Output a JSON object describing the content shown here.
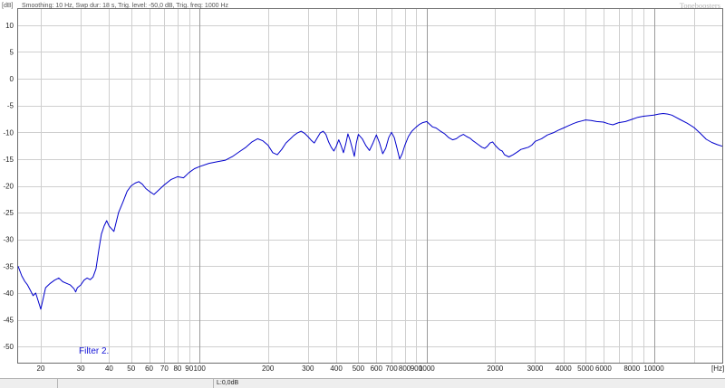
{
  "chart_data": {
    "type": "line",
    "header": "Smoothing: 10 Hz, Swp dur: 18 s, Trig. level: -50,0 dB, Trig. freq: 1000 Hz",
    "brand": "Toneboosters",
    "ylabel": "[dB]",
    "xlabel": "[Hz]",
    "x_scale": "log",
    "xlim": [
      15.9,
      20000
    ],
    "ylim": [
      -53,
      13
    ],
    "grid": true,
    "y_ticks": [
      10,
      5,
      0,
      -5,
      -10,
      -15,
      -20,
      -25,
      -30,
      -35,
      -40,
      -45,
      -50
    ],
    "x_ticks": [
      {
        "value": 20,
        "label": "20"
      },
      {
        "value": 30,
        "label": "30"
      },
      {
        "value": 40,
        "label": "40"
      },
      {
        "value": 50,
        "label": "50"
      },
      {
        "value": 60,
        "label": "60"
      },
      {
        "value": 70,
        "label": "70"
      },
      {
        "value": 80,
        "label": "80"
      },
      {
        "value": 90,
        "label": "90"
      },
      {
        "value": 100,
        "label": "100"
      },
      {
        "value": 200,
        "label": "200"
      },
      {
        "value": 300,
        "label": "300"
      },
      {
        "value": 400,
        "label": "400"
      },
      {
        "value": 500,
        "label": "500"
      },
      {
        "value": 600,
        "label": "600"
      },
      {
        "value": 700,
        "label": "700"
      },
      {
        "value": 800,
        "label": "800"
      },
      {
        "value": 900,
        "label": "900"
      },
      {
        "value": 1000,
        "label": "1000"
      },
      {
        "value": 2000,
        "label": "2000"
      },
      {
        "value": 3000,
        "label": "3000"
      },
      {
        "value": 4000,
        "label": "4000"
      },
      {
        "value": 5000,
        "label": "5000"
      },
      {
        "value": 6000,
        "label": "6000"
      },
      {
        "value": 8000,
        "label": "8000"
      },
      {
        "value": 10000,
        "label": "10000"
      }
    ],
    "series": [
      {
        "color": "#0000cc",
        "x": [
          15.9,
          16.5,
          17.0,
          17.5,
          18.0,
          18.5,
          19.0,
          19.5,
          20.0,
          20.5,
          21.0,
          22.0,
          23.0,
          24.0,
          25.0,
          26.0,
          27.0,
          28.0,
          28.5,
          29.0,
          30.0,
          31.0,
          32.0,
          33.0,
          34.0,
          35.0,
          36.0,
          37.0,
          38.0,
          39.0,
          40.0,
          42.0,
          44.0,
          46.0,
          48.0,
          50.0,
          52.0,
          54.0,
          56.0,
          58.0,
          60.0,
          63.0,
          66.0,
          70.0,
          75.0,
          80.0,
          85.0,
          90.0,
          95.0,
          100.0,
          110.0,
          120.0,
          130.0,
          140.0,
          150.0,
          160.0,
          170.0,
          180.0,
          190.0,
          200.0,
          210.0,
          220.0,
          230.0,
          240.0,
          250.0,
          260.0,
          270.0,
          280.0,
          290.0,
          300.0,
          310.0,
          320.0,
          330.0,
          340.0,
          350.0,
          360.0,
          370.0,
          380.0,
          390.0,
          400.0,
          410.0,
          420.0,
          430.0,
          440.0,
          450.0,
          460.0,
          470.0,
          480.0,
          490.0,
          500.0,
          520.0,
          540.0,
          560.0,
          580.0,
          600.0,
          620.0,
          640.0,
          660.0,
          680.0,
          700.0,
          720.0,
          740.0,
          760.0,
          780.0,
          800.0,
          830.0,
          860.0,
          900.0,
          930.0,
          960.0,
          1000.0,
          1030.0,
          1060.0,
          1100.0,
          1150.0,
          1200.0,
          1250.0,
          1300.0,
          1350.0,
          1400.0,
          1450.0,
          1500.0,
          1550.0,
          1600.0,
          1650.0,
          1700.0,
          1750.0,
          1800.0,
          1850.0,
          1900.0,
          1950.0,
          2000.0,
          2050.0,
          2100.0,
          2150.0,
          2200.0,
          2300.0,
          2400.0,
          2500.0,
          2600.0,
          2700.0,
          2800.0,
          2900.0,
          3000.0,
          3200.0,
          3400.0,
          3600.0,
          3800.0,
          4000.0,
          4200.0,
          4400.0,
          4600.0,
          4800.0,
          5000.0,
          5300.0,
          5600.0,
          6000.0,
          6300.0,
          6600.0,
          7000.0,
          7500.0,
          8000.0,
          8500.0,
          9000.0,
          9500.0,
          10000.0,
          10500.0,
          11000.0,
          11500.0,
          12000.0,
          12500.0,
          13000.0,
          14000.0,
          15000.0,
          16000.0,
          17000.0,
          18000.0,
          19000.0,
          20000.0
        ],
        "y": [
          -35.0,
          -36.8,
          -37.8,
          -38.5,
          -39.5,
          -40.5,
          -40.0,
          -41.5,
          -43.0,
          -41.0,
          -39.0,
          -38.2,
          -37.6,
          -37.2,
          -37.9,
          -38.2,
          -38.5,
          -39.2,
          -39.8,
          -39.0,
          -38.5,
          -37.6,
          -37.2,
          -37.5,
          -37.0,
          -35.5,
          -32.0,
          -29.0,
          -27.5,
          -26.5,
          -27.5,
          -28.5,
          -25.0,
          -23.0,
          -21.0,
          -20.0,
          -19.5,
          -19.2,
          -19.7,
          -20.5,
          -21.0,
          -21.6,
          -20.8,
          -19.8,
          -18.8,
          -18.3,
          -18.5,
          -17.5,
          -16.8,
          -16.4,
          -15.8,
          -15.5,
          -15.2,
          -14.5,
          -13.6,
          -12.8,
          -11.8,
          -11.2,
          -11.6,
          -12.4,
          -13.8,
          -14.2,
          -13.2,
          -12.0,
          -11.3,
          -10.6,
          -10.1,
          -9.8,
          -10.2,
          -10.8,
          -11.5,
          -12.0,
          -11.0,
          -10.1,
          -9.8,
          -10.4,
          -11.8,
          -12.8,
          -13.5,
          -12.6,
          -11.4,
          -12.5,
          -13.8,
          -12.2,
          -10.3,
          -11.5,
          -13.0,
          -14.5,
          -12.0,
          -10.4,
          -11.2,
          -12.5,
          -13.4,
          -12.0,
          -10.5,
          -12.0,
          -14.0,
          -13.0,
          -11.0,
          -10.0,
          -11.0,
          -13.0,
          -15.0,
          -14.0,
          -12.5,
          -10.8,
          -9.8,
          -9.0,
          -8.5,
          -8.2,
          -8.0,
          -8.5,
          -9.0,
          -9.2,
          -9.8,
          -10.3,
          -11.0,
          -11.4,
          -11.2,
          -10.7,
          -10.4,
          -10.8,
          -11.1,
          -11.6,
          -12.0,
          -12.4,
          -12.8,
          -13.0,
          -12.6,
          -12.0,
          -11.8,
          -12.4,
          -12.9,
          -13.3,
          -13.5,
          -14.2,
          -14.6,
          -14.2,
          -13.7,
          -13.2,
          -13.0,
          -12.8,
          -12.4,
          -11.7,
          -11.2,
          -10.5,
          -10.1,
          -9.6,
          -9.2,
          -8.8,
          -8.4,
          -8.1,
          -7.9,
          -7.7,
          -7.8,
          -8.0,
          -8.1,
          -8.4,
          -8.6,
          -8.2,
          -8.0,
          -7.6,
          -7.2,
          -7.0,
          -6.9,
          -6.8,
          -6.6,
          -6.5,
          -6.6,
          -6.8,
          -7.2,
          -7.6,
          -8.3,
          -9.1,
          -10.2,
          -11.3,
          -11.9,
          -12.3,
          -12.6
        ]
      }
    ]
  },
  "status_bar": {
    "level": "L:0,0dB"
  }
}
